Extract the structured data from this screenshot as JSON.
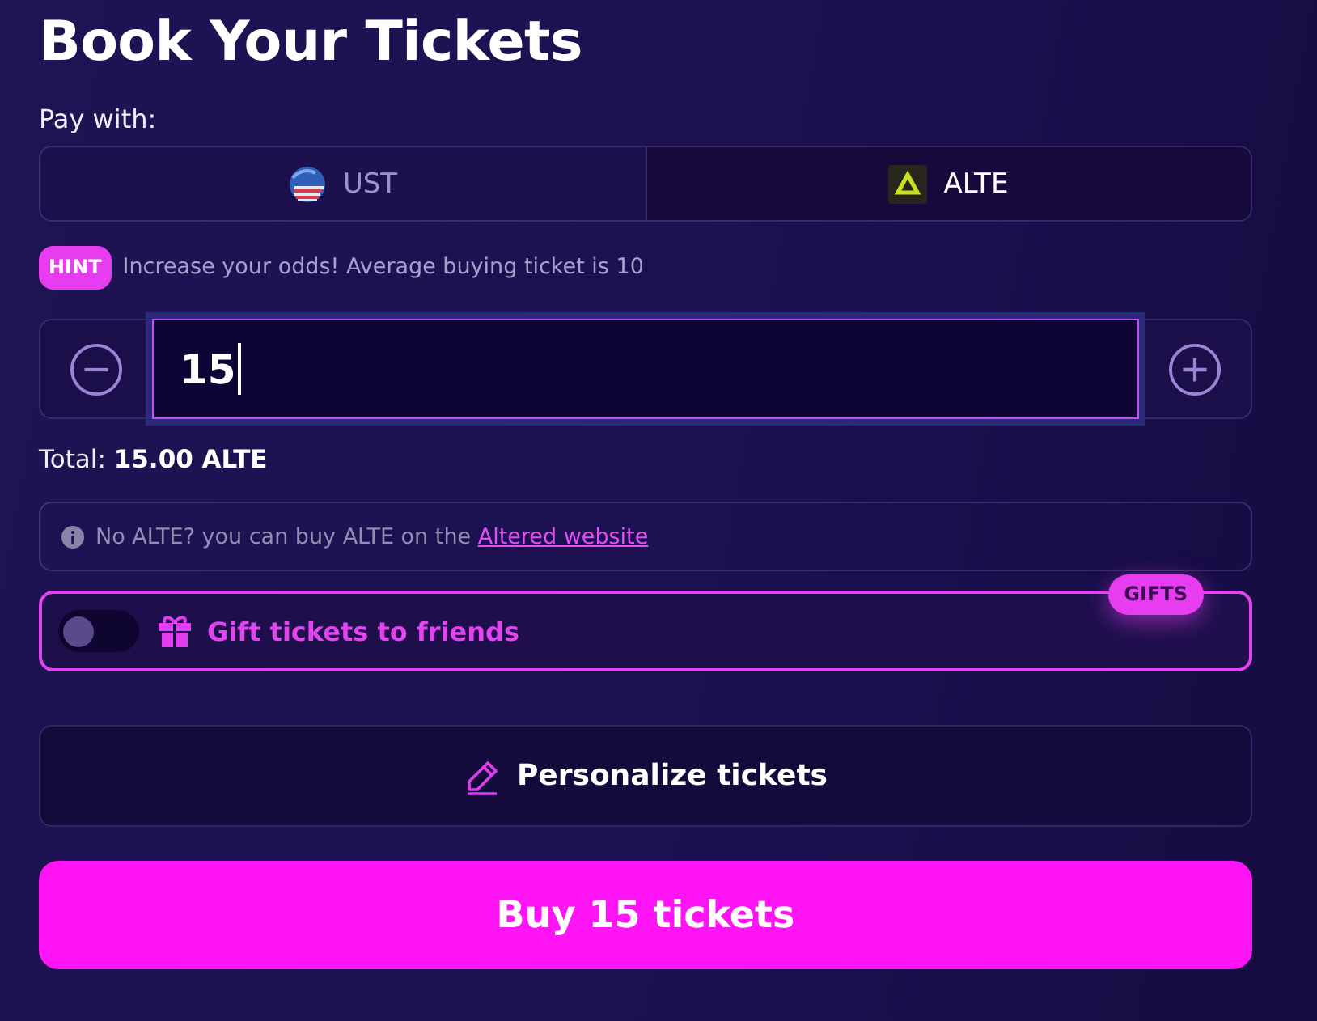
{
  "title": "Book Your Tickets",
  "payment": {
    "label": "Pay with:",
    "options": [
      {
        "label": "UST",
        "kind": "flag",
        "selected": false
      },
      {
        "label": "ALTE",
        "kind": "logo",
        "selected": true
      }
    ]
  },
  "hint": {
    "badge": "HINT",
    "text": "Increase your odds! Average buying ticket is 10"
  },
  "quantity": {
    "value": "15",
    "focused": true
  },
  "total": "Total: **15.00 ALTE**",
  "notice": {
    "text": "No ALTE? you can buy ALTE on the",
    "link": "Altered website"
  },
  "gift": {
    "label": "Gift tickets to friends",
    "badge": "GIFTS",
    "on": false
  },
  "personalize_button": "Personalize tickets",
  "buy_button": "Buy 15 tickets"
}
